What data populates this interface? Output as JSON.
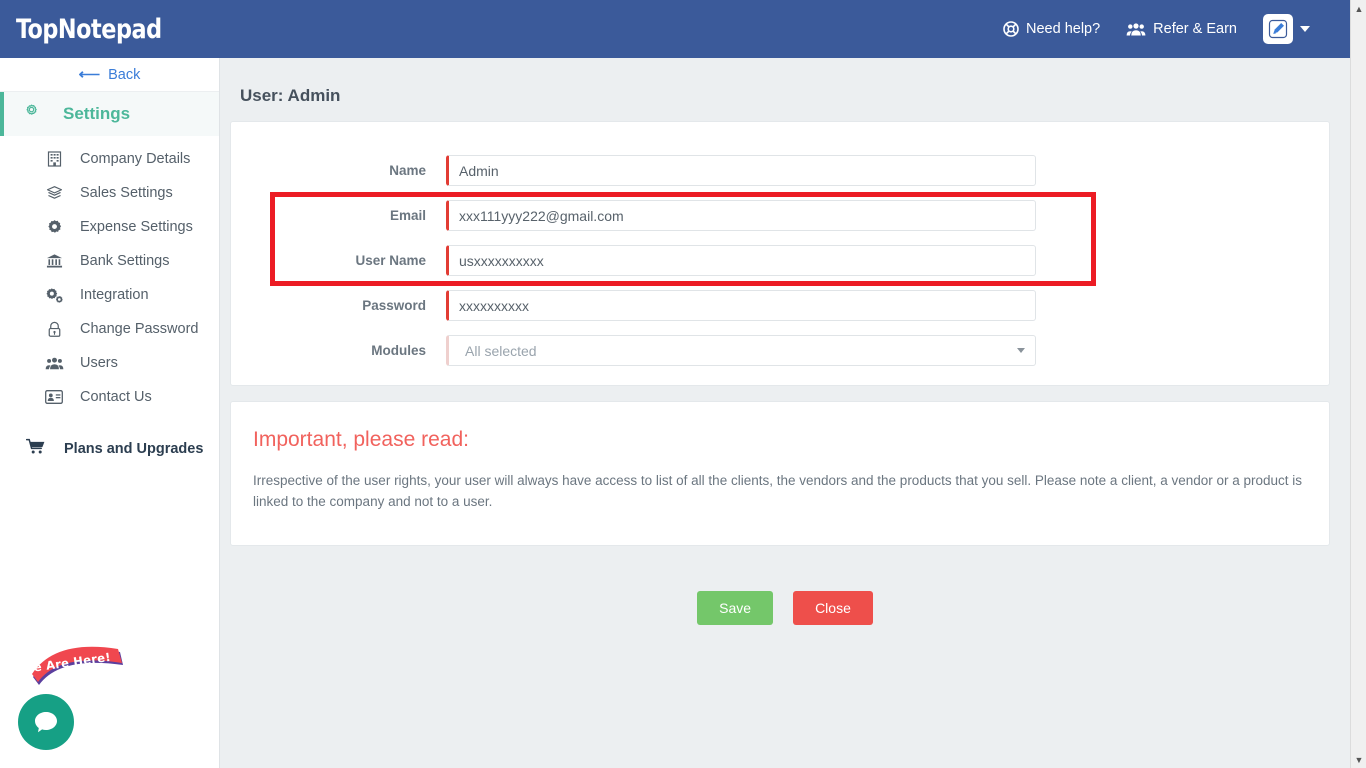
{
  "header": {
    "brand": "TopNotepad",
    "need_help": "Need help?",
    "refer_earn": "Refer & Earn"
  },
  "sidebar": {
    "back": "Back",
    "settings": "Settings",
    "items": [
      {
        "label": "Company Details",
        "icon": "building-icon"
      },
      {
        "label": "Sales Settings",
        "icon": "layers-icon"
      },
      {
        "label": "Expense Settings",
        "icon": "cog-icon"
      },
      {
        "label": "Bank Settings",
        "icon": "bank-icon"
      },
      {
        "label": "Integration",
        "icon": "cogs-icon"
      },
      {
        "label": "Change Password",
        "icon": "lock-icon"
      },
      {
        "label": "Users",
        "icon": "users-icon"
      },
      {
        "label": "Contact Us",
        "icon": "id-card-icon"
      }
    ],
    "plans": "Plans and Upgrades"
  },
  "chat": {
    "banner": "We Are Here!",
    "icon": "chat-bubble-icon"
  },
  "main": {
    "page_title": "User: Admin",
    "form": {
      "fields": [
        {
          "label": "Name",
          "value": "Admin",
          "type": "text"
        },
        {
          "label": "Email",
          "value": "xxx111yyy222@gmail.com",
          "type": "text"
        },
        {
          "label": "User Name",
          "value": "usxxxxxxxxxx",
          "type": "text"
        },
        {
          "label": "Password",
          "value": "xxxxxxxxxx",
          "type": "text"
        },
        {
          "label": "Modules",
          "value": "All selected",
          "type": "select"
        }
      ]
    },
    "note": {
      "title": "Important, please read:",
      "body": "Irrespective of the user rights, your user will always have access to list of all the clients, the vendors and the products that you sell. Please note a client, a vendor or a product is linked to the company and not to a user."
    },
    "buttons": {
      "save": "Save",
      "close": "Close"
    }
  },
  "colors": {
    "header_bg": "#3b5a9a",
    "accent_teal": "#4cb79a",
    "field_accent": "#e23c34",
    "annotation": "#ec1c24",
    "save": "#74c76a",
    "close": "#ee4f4b",
    "note_title": "#f1625d",
    "page_bg": "#eceff1"
  },
  "scrollbar": {
    "up": "▲",
    "down": "▼"
  }
}
